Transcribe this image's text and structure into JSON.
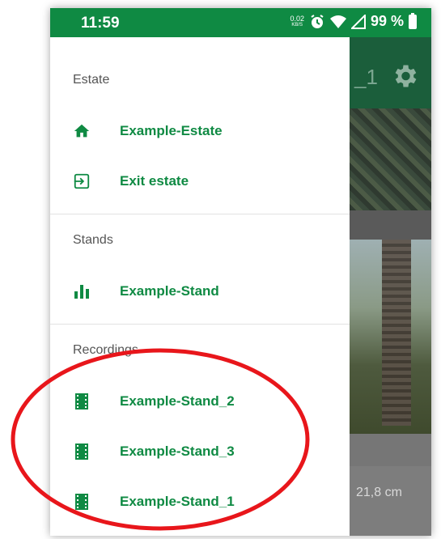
{
  "status_bar": {
    "time": "11:59",
    "net_speed_value": "0.02",
    "net_speed_unit": "KB/S",
    "battery": "99 %"
  },
  "drawer": {
    "sections": [
      {
        "title": "Estate",
        "items": [
          {
            "label": "Example-Estate",
            "icon": "home-icon"
          },
          {
            "label": "Exit estate",
            "icon": "exit-icon"
          }
        ]
      },
      {
        "title": "Stands",
        "items": [
          {
            "label": "Example-Stand",
            "icon": "bar-chart-icon"
          }
        ]
      },
      {
        "title": "Recordings",
        "items": [
          {
            "label": "Example-Stand_2",
            "icon": "film-icon"
          },
          {
            "label": "Example-Stand_3",
            "icon": "film-icon"
          },
          {
            "label": "Example-Stand_1",
            "icon": "film-icon"
          }
        ]
      }
    ]
  },
  "background_app": {
    "toolbar_title_fragment": "_1",
    "measurement": "21,8 cm"
  },
  "colors": {
    "brand_green": "#0f8a43",
    "annotation_red": "#e8161b"
  }
}
